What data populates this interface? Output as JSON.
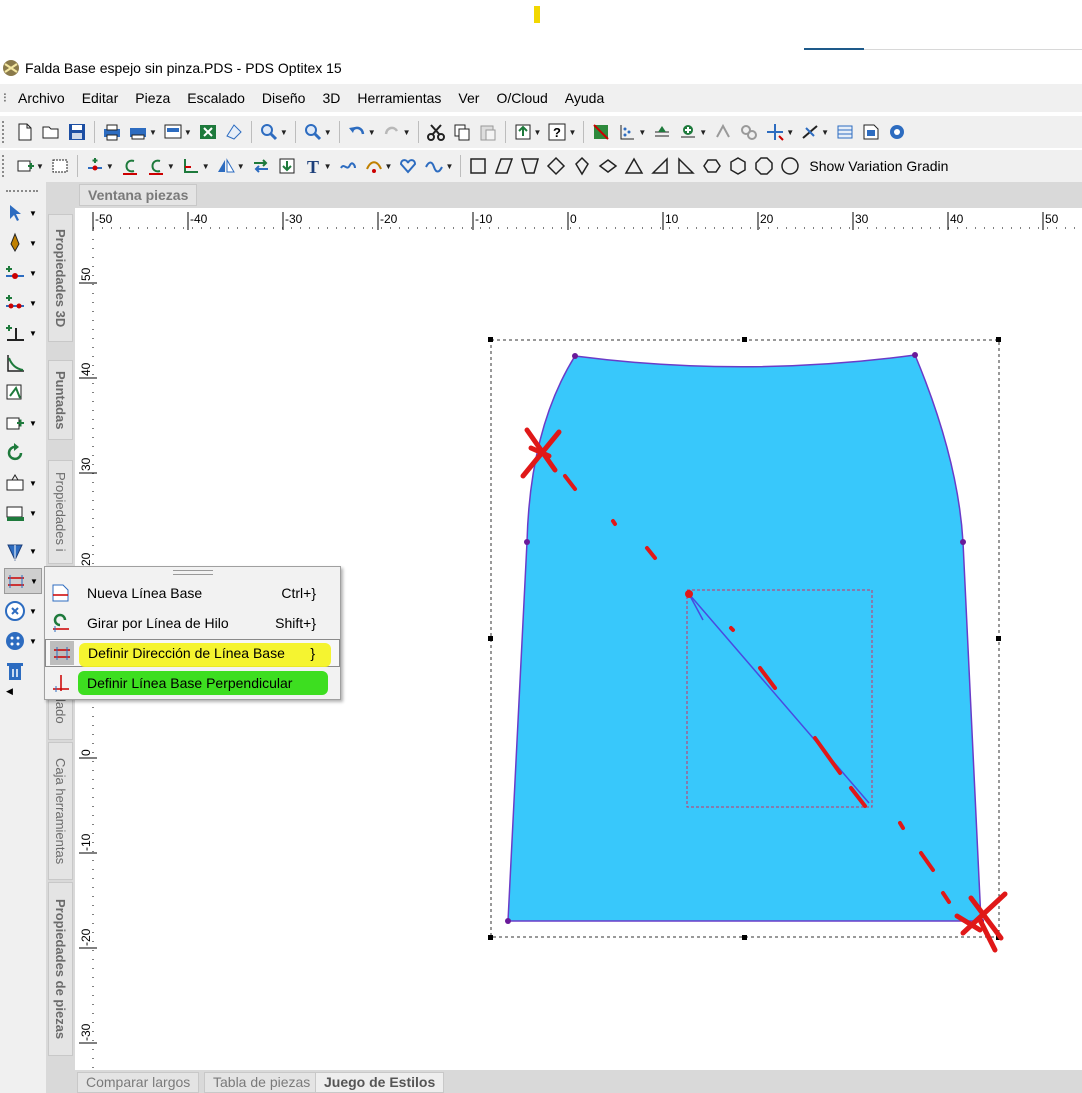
{
  "window": {
    "title": "Falda Base espejo sin pinza.PDS - PDS Optitex 15"
  },
  "menu": [
    "Archivo",
    "Editar",
    "Pieza",
    "Escalado",
    "Diseño",
    "3D",
    "Herramientas",
    "Ver",
    "O/Cloud",
    "Ayuda"
  ],
  "toolbar2": {
    "show_variation_label": "Show Variation Gradin"
  },
  "panel_tab": "Ventana piezas",
  "side_tabs": [
    "Propiedades 3D",
    "Puntadas",
    "Propiedades i",
    "lado",
    "Caja herramientas",
    "Propiedades de piezas"
  ],
  "bottom_tabs": [
    "Comparar largos",
    "Tabla de piezas",
    "Juego de Estilos"
  ],
  "ruler": {
    "top_ticks": [
      "-50",
      "-40",
      "-30",
      "-20",
      "-10",
      "0",
      "10",
      "20",
      "30",
      "40",
      "50"
    ],
    "left_ticks": [
      "50",
      "40",
      "30",
      "20",
      "10",
      "0",
      "-10",
      "-20",
      "-30"
    ]
  },
  "context_menu": {
    "items": [
      {
        "label": "Nueva Línea Base",
        "shortcut": "Ctrl+}",
        "icon": "new-baseline-icon"
      },
      {
        "label": "Girar por Línea de Hilo",
        "shortcut": "Shift+}",
        "icon": "rotate-grainline-icon"
      },
      {
        "label": "Definir Dirección de Línea Base",
        "shortcut": "}",
        "icon": "baseline-direction-icon",
        "highlight": "yellow",
        "selected": true
      },
      {
        "label": "Definir Línea Base Perpendicular",
        "shortcut": "",
        "icon": "perpendicular-baseline-icon",
        "highlight": "green"
      }
    ]
  },
  "colors": {
    "piece_fill": "#38c8fb",
    "piece_outline": "#6a3cc8",
    "annotation_red": "#e01818",
    "highlight_yellow": "#f4f31a",
    "highlight_green": "#33dc14"
  }
}
